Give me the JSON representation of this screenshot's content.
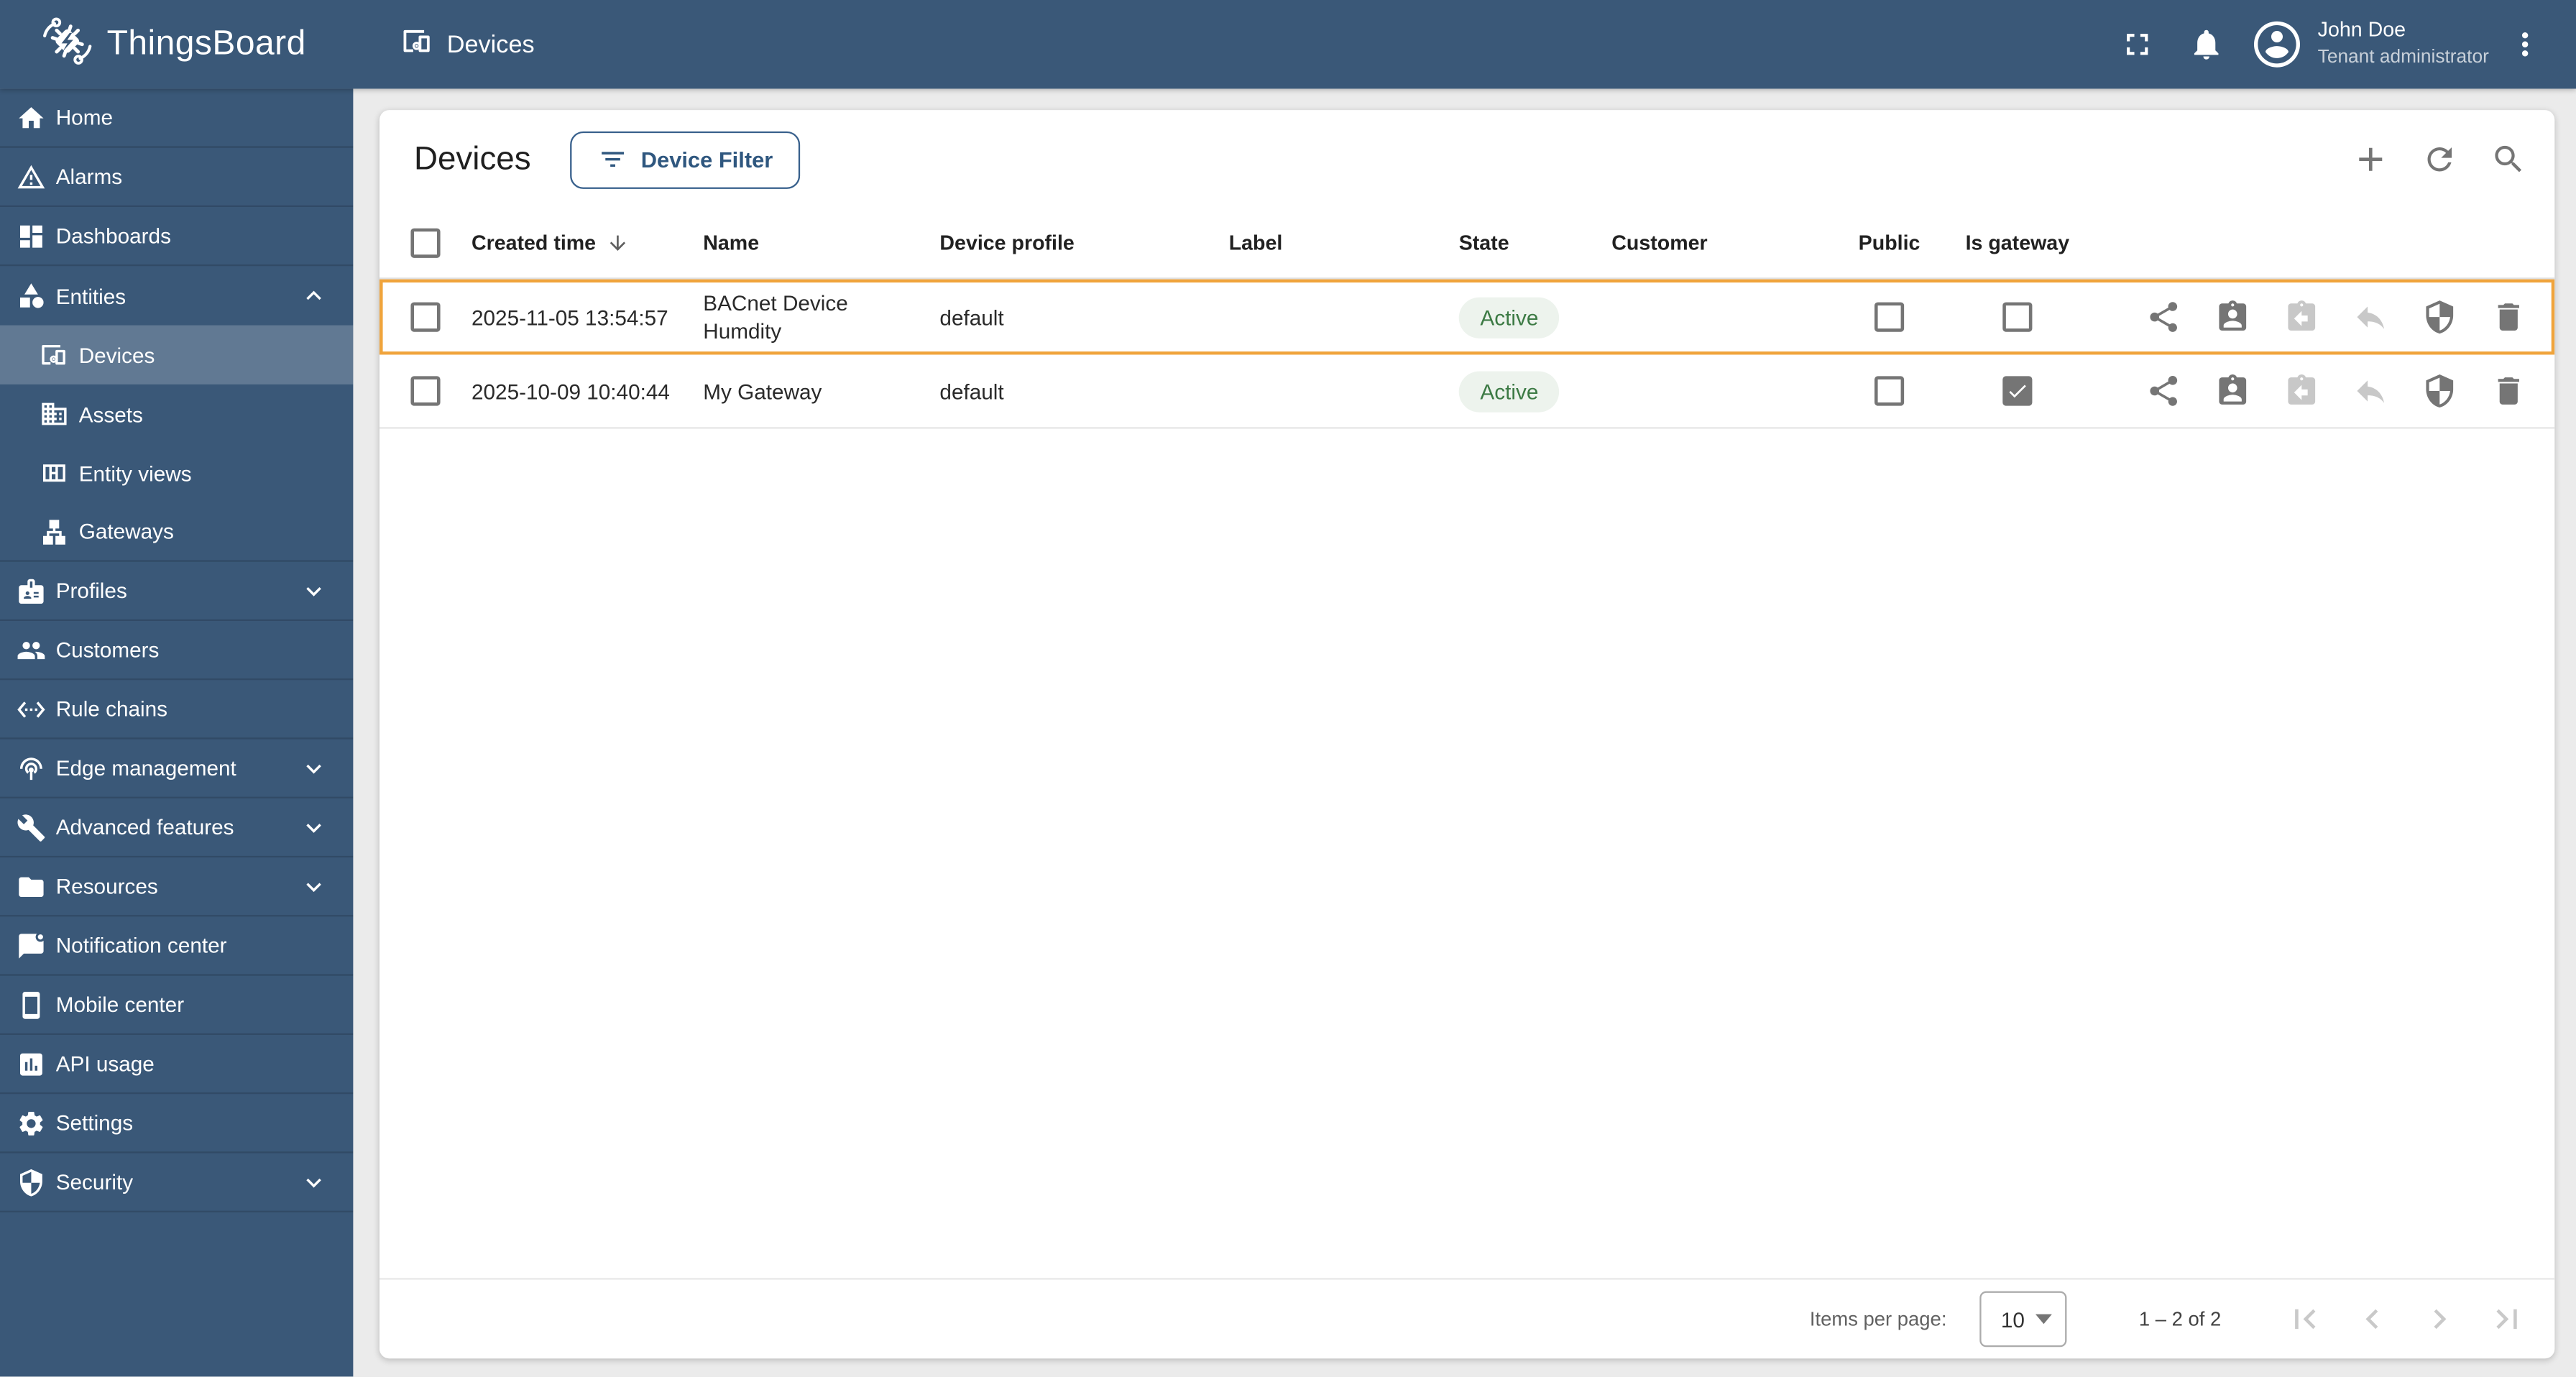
{
  "colors": {
    "brand_blue": "#3a5878",
    "highlight_orange": "#f0a43c",
    "active_text_green": "#3c7a44",
    "active_badge_bg": "#edf3ed",
    "button_blue": "#2f577f"
  },
  "topbar": {
    "brand": "ThingsBoard",
    "breadcrumb": "Devices",
    "user": {
      "name": "John Doe",
      "role": "Tenant administrator"
    }
  },
  "sidebar": {
    "items": [
      {
        "label": "Home"
      },
      {
        "label": "Alarms"
      },
      {
        "label": "Dashboards"
      },
      {
        "label": "Entities",
        "expanded": true
      },
      {
        "label": "Devices",
        "selected": true
      },
      {
        "label": "Assets"
      },
      {
        "label": "Entity views"
      },
      {
        "label": "Gateways"
      },
      {
        "label": "Profiles",
        "collapsible": true
      },
      {
        "label": "Customers"
      },
      {
        "label": "Rule chains"
      },
      {
        "label": "Edge management",
        "collapsible": true
      },
      {
        "label": "Advanced features",
        "collapsible": true
      },
      {
        "label": "Resources",
        "collapsible": true
      },
      {
        "label": "Notification center"
      },
      {
        "label": "Mobile center"
      },
      {
        "label": "API usage"
      },
      {
        "label": "Settings"
      },
      {
        "label": "Security",
        "collapsible": true
      }
    ]
  },
  "content": {
    "title": "Devices",
    "filter_button": "Device Filter",
    "toolbar_icons": [
      "add-icon",
      "refresh-icon",
      "search-icon"
    ],
    "table": {
      "columns": [
        "Created time",
        "Name",
        "Device profile",
        "Label",
        "State",
        "Customer",
        "Public",
        "Is gateway"
      ],
      "sorted_column": "Created time",
      "sort_direction": "desc",
      "row_action_icons": [
        "share-icon",
        "assign-to-customer-icon",
        "unassign-from-customer-icon",
        "make-private-icon",
        "manage-credentials-icon",
        "delete-icon"
      ],
      "rows": [
        {
          "created_time": "2025-11-05 13:54:57",
          "name": "BACnet Device Humdity",
          "device_profile": "default",
          "label": "",
          "state": "Active",
          "customer": "",
          "public": false,
          "is_gateway": false,
          "highlighted": true
        },
        {
          "created_time": "2025-10-09 10:40:44",
          "name": "My Gateway",
          "device_profile": "default",
          "label": "",
          "state": "Active",
          "customer": "",
          "public": false,
          "is_gateway": true,
          "highlighted": false
        }
      ]
    },
    "pagination": {
      "items_per_page_label": "Items per page:",
      "items_per_page": "10",
      "range": "1 – 2 of 2"
    }
  }
}
